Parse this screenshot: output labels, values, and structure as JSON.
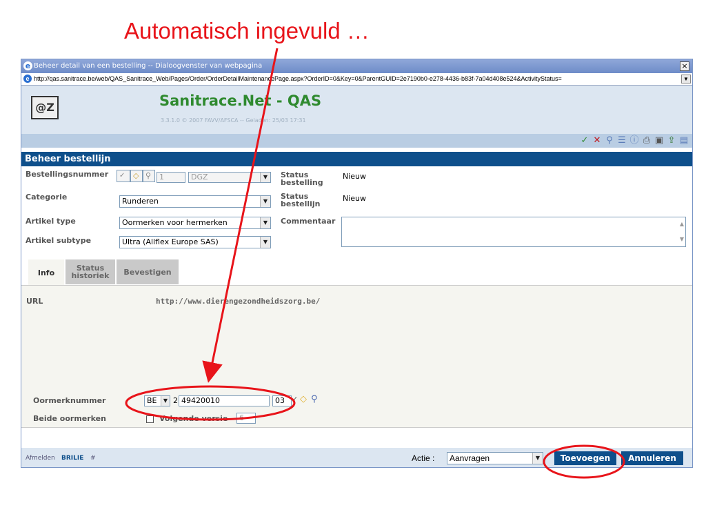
{
  "headline": "Automatisch ingevuld …",
  "window": {
    "title": "Beheer detail van een bestelling -- Dialoogvenster van webpagina",
    "close_glyph": "×",
    "url": "http://qas.sanitrace.be/web/QAS_Sanitrace_Web/Pages/Order/OrderDetailMaintenancePage.aspx?OrderID=0&Key=0&ParentGUID=2e7190b0-e278-4436-b83f-7a04d408e524&ActivityStatus="
  },
  "banner": {
    "logo_text": "@Z",
    "app_title": "Sanitrace.Net - QAS",
    "app_subtitle": "3.3.1.0 © 2007 FAVV/AFSCA -- Geladen: 25/03 17:31"
  },
  "toolbar_icons": [
    "check-icon",
    "cross-icon",
    "search-icon",
    "list-icon",
    "info-icon",
    "print-icon",
    "save-icon",
    "export-icon",
    "note-icon"
  ],
  "section_title": "Beheer bestellijn",
  "form": {
    "bestellingsnummer": {
      "label": "Bestellingsnummer",
      "number": "1",
      "type": "DGZ"
    },
    "categorie": {
      "label": "Categorie",
      "value": "Runderen"
    },
    "artikel_type": {
      "label": "Artikel type",
      "value": "Oormerken voor hermerken"
    },
    "artikel_subtype": {
      "label": "Artikel subtype",
      "value": "Ultra (Allflex Europe SAS)"
    },
    "status_bestelling": {
      "label": "Status bestelling",
      "value": "Nieuw"
    },
    "status_bestellijn": {
      "label": "Status bestellijn",
      "value": "Nieuw"
    },
    "commentaar": {
      "label": "Commentaar",
      "value": ""
    }
  },
  "tabs": [
    "Info",
    "Status historiek",
    "Bevestigen"
  ],
  "info": {
    "url_label": "URL",
    "url_value": "http://www.dierengezondheidszorg.be/",
    "oormerk_label": "Oormerknummer",
    "country": "BE",
    "check_digit": "2",
    "number": "49420010",
    "suffix": "03",
    "beide_label": "Beide oormerken",
    "volgende_label": "Volgende versie",
    "volgende_value": "6"
  },
  "footer": {
    "afmelden": "Afmelden",
    "user": "BRILIE",
    "hash": "#",
    "actie_label": "Actie :",
    "actie_value": "Aanvragen",
    "add_label": "Toevoegen",
    "cancel_label": "Annuleren"
  },
  "colors": {
    "annotation": "#e8141a",
    "header_blue": "#0e4f8b",
    "brand_green": "#2f8a2f"
  }
}
